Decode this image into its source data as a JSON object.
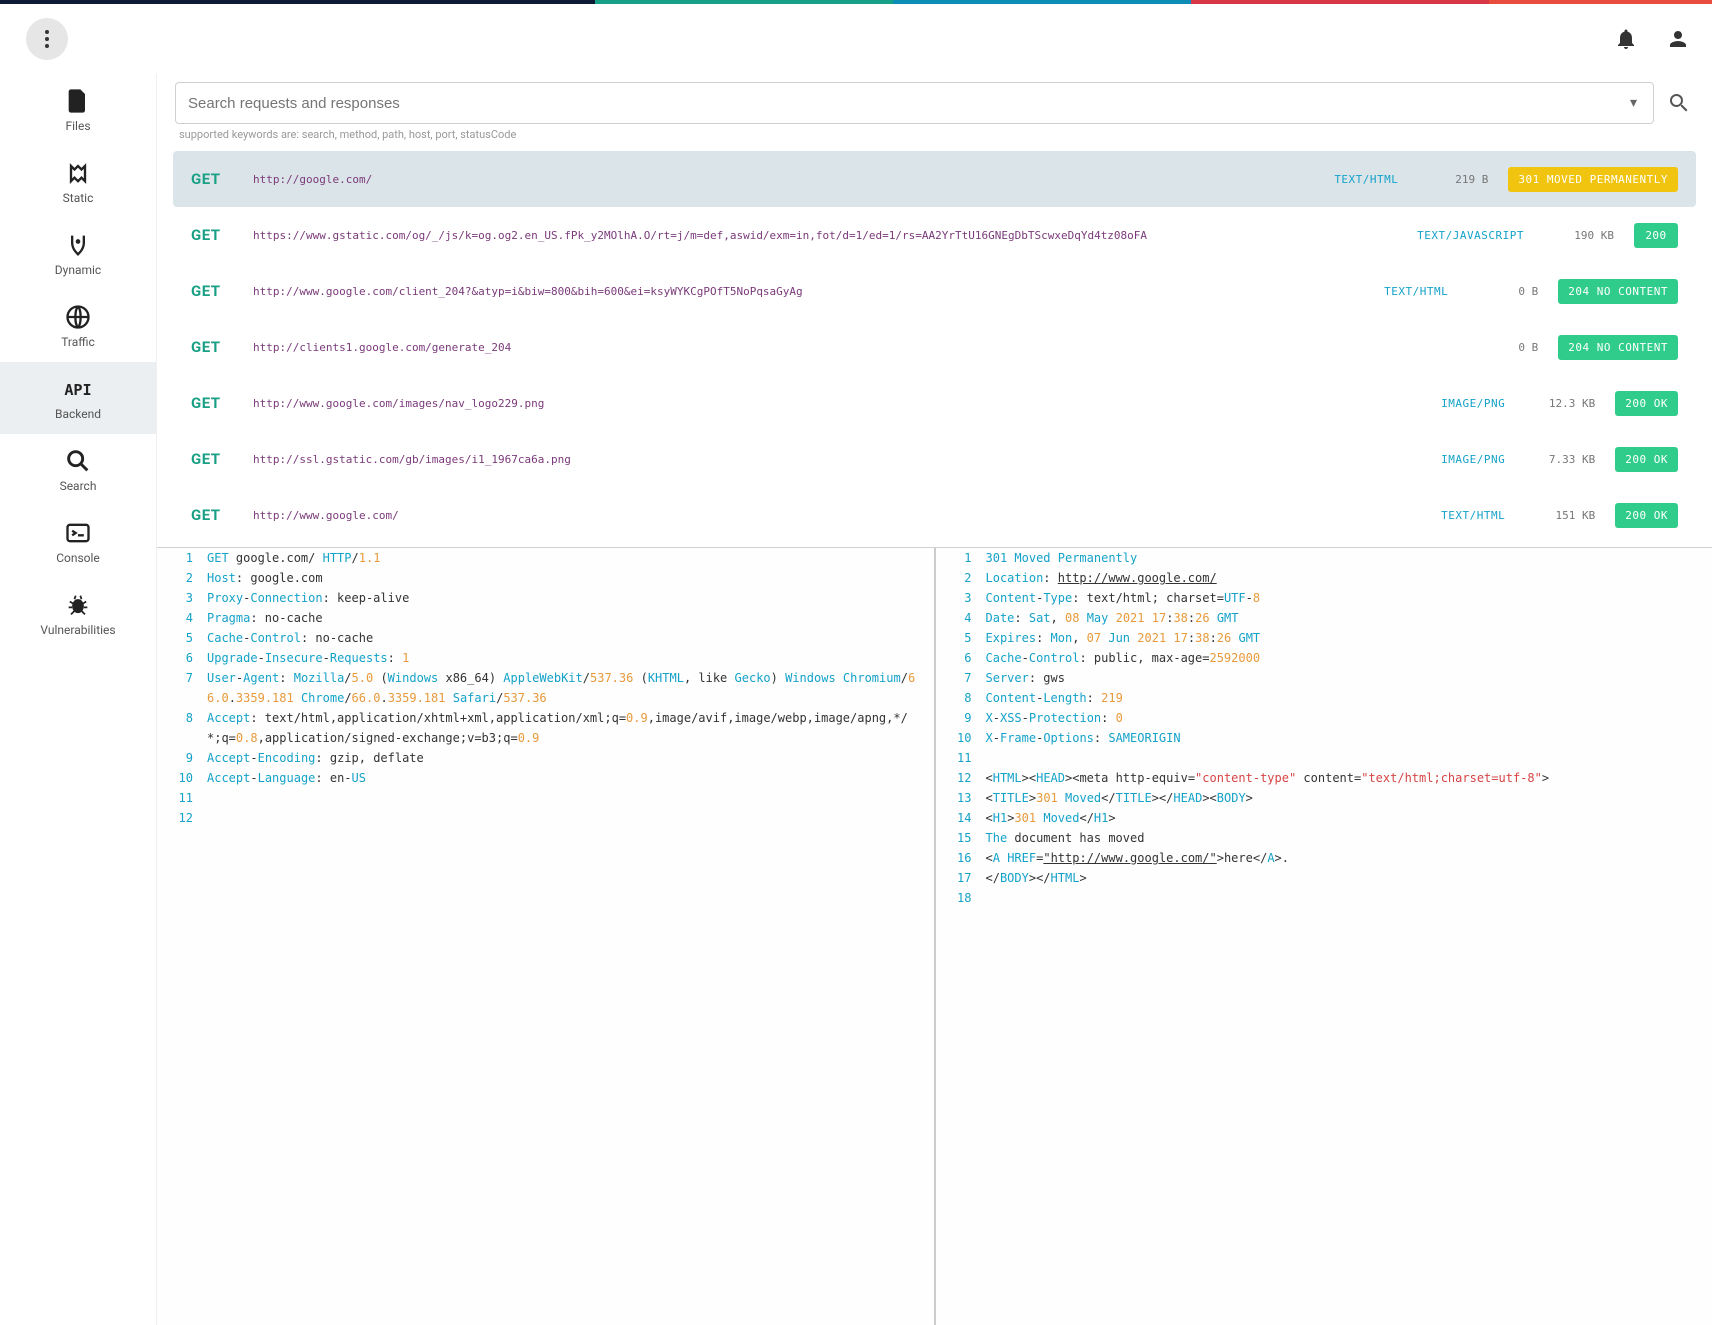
{
  "search": {
    "placeholder": "Search requests and responses",
    "hint": "supported keywords are: search, method, path, host, port, statusCode"
  },
  "sidebar": [
    {
      "id": "files",
      "label": "Files"
    },
    {
      "id": "static",
      "label": "Static"
    },
    {
      "id": "dynamic",
      "label": "Dynamic"
    },
    {
      "id": "traffic",
      "label": "Traffic"
    },
    {
      "id": "backend",
      "label": "Backend",
      "active": true
    },
    {
      "id": "search",
      "label": "Search"
    },
    {
      "id": "console",
      "label": "Console"
    },
    {
      "id": "vulnerabilities",
      "label": "Vulnerabilities"
    }
  ],
  "requests": [
    {
      "method": "GET",
      "url": "http://google.com/",
      "ct": "TEXT/HTML",
      "size": "219 B",
      "status": "301 MOVED PERMANENTLY",
      "style": "orange",
      "selected": true
    },
    {
      "method": "GET",
      "url": "https://www.gstatic.com/og/_/js/k=og.og2.en_US.fPk_y2MOlhA.O/rt=j/m=def,aswid/exm=in,fot/d=1/ed=1/rs=AA2YrTtU16GNEgDbTScwxeDqYd4tz08oFA",
      "ct": "TEXT/JAVASCRIPT",
      "size": "190 KB",
      "status": "200",
      "style": "green-sm"
    },
    {
      "method": "GET",
      "url": "http://www.google.com/client_204?&atyp=i&biw=800&bih=600&ei=ksyWYKCgPOfT5NoPqsaGyAg",
      "ct": "TEXT/HTML",
      "size": "0 B",
      "status": "204 NO CONTENT",
      "style": "green"
    },
    {
      "method": "GET",
      "url": "http://clients1.google.com/generate_204",
      "ct": "",
      "size": "0 B",
      "status": "204 NO CONTENT",
      "style": "green"
    },
    {
      "method": "GET",
      "url": "http://www.google.com/images/nav_logo229.png",
      "ct": "IMAGE/PNG",
      "size": "12.3 KB",
      "status": "200 OK",
      "style": "green"
    },
    {
      "method": "GET",
      "url": "http://ssl.gstatic.com/gb/images/i1_1967ca6a.png",
      "ct": "IMAGE/PNG",
      "size": "7.33 KB",
      "status": "200 OK",
      "style": "green"
    },
    {
      "method": "GET",
      "url": "http://www.google.com/",
      "ct": "TEXT/HTML",
      "size": "151 KB",
      "status": "200 OK",
      "style": "green"
    }
  ],
  "request_lines": [
    [
      {
        "t": "GET",
        "c": "kw"
      },
      {
        "t": " google.com/ "
      },
      {
        "t": "HTTP",
        "c": "kw"
      },
      {
        "t": "/"
      },
      {
        "t": "1.1",
        "c": "num"
      }
    ],
    [
      {
        "t": "Host",
        "c": "kw"
      },
      {
        "t": ": google.com"
      }
    ],
    [
      {
        "t": "Proxy",
        "c": "kw"
      },
      {
        "t": "-"
      },
      {
        "t": "Connection",
        "c": "kw"
      },
      {
        "t": ": keep-alive"
      }
    ],
    [
      {
        "t": "Pragma",
        "c": "kw"
      },
      {
        "t": ": no-cache"
      }
    ],
    [
      {
        "t": "Cache",
        "c": "kw"
      },
      {
        "t": "-"
      },
      {
        "t": "Control",
        "c": "kw"
      },
      {
        "t": ": no-cache"
      }
    ],
    [
      {
        "t": "Upgrade",
        "c": "kw"
      },
      {
        "t": "-"
      },
      {
        "t": "Insecure",
        "c": "kw"
      },
      {
        "t": "-"
      },
      {
        "t": "Requests",
        "c": "kw"
      },
      {
        "t": ": "
      },
      {
        "t": "1",
        "c": "num"
      }
    ],
    [
      {
        "t": "User",
        "c": "kw"
      },
      {
        "t": "-"
      },
      {
        "t": "Agent",
        "c": "kw"
      },
      {
        "t": ": "
      },
      {
        "t": "Mozilla",
        "c": "kw"
      },
      {
        "t": "/"
      },
      {
        "t": "5.0",
        "c": "num"
      },
      {
        "t": " ("
      },
      {
        "t": "Windows",
        "c": "kw"
      },
      {
        "t": " x86_64) "
      },
      {
        "t": "AppleWebKit",
        "c": "kw"
      },
      {
        "t": "/"
      },
      {
        "t": "537.36",
        "c": "num"
      },
      {
        "t": " ("
      },
      {
        "t": "KHTML",
        "c": "kw"
      },
      {
        "t": ", like "
      },
      {
        "t": "Gecko",
        "c": "kw"
      },
      {
        "t": ") "
      },
      {
        "t": "Windows",
        "c": "kw"
      },
      {
        "t": " "
      },
      {
        "t": "Chromium",
        "c": "kw"
      },
      {
        "t": "/"
      },
      {
        "t": "66.0",
        "c": "num"
      },
      {
        "t": "."
      },
      {
        "t": "3359.181",
        "c": "num"
      },
      {
        "t": " "
      },
      {
        "t": "Chrome",
        "c": "kw"
      },
      {
        "t": "/"
      },
      {
        "t": "66.0",
        "c": "num"
      },
      {
        "t": "."
      },
      {
        "t": "3359.181",
        "c": "num"
      },
      {
        "t": " "
      },
      {
        "t": "Safari",
        "c": "kw"
      },
      {
        "t": "/"
      },
      {
        "t": "537.36",
        "c": "num"
      }
    ],
    [
      {
        "t": "Accept",
        "c": "kw"
      },
      {
        "t": ": text/html,application/xhtml+xml,application/xml;q="
      },
      {
        "t": "0.9",
        "c": "num"
      },
      {
        "t": ",image/avif,image/webp,image/apng,*/*;q="
      },
      {
        "t": "0.8",
        "c": "num"
      },
      {
        "t": ",application/signed-exchange;v=b3;q="
      },
      {
        "t": "0.9",
        "c": "num"
      }
    ],
    [
      {
        "t": "Accept",
        "c": "kw"
      },
      {
        "t": "-"
      },
      {
        "t": "Encoding",
        "c": "kw"
      },
      {
        "t": ": gzip, deflate"
      }
    ],
    [
      {
        "t": "Accept",
        "c": "kw"
      },
      {
        "t": "-"
      },
      {
        "t": "Language",
        "c": "kw"
      },
      {
        "t": ": en-"
      },
      {
        "t": "US",
        "c": "kw"
      }
    ],
    [],
    []
  ],
  "response_lines": [
    [
      {
        "t": "301 Moved Permanently",
        "c": "kw"
      }
    ],
    [
      {
        "t": "Location",
        "c": "kw"
      },
      {
        "t": ": "
      },
      {
        "t": "http://www.google.com/",
        "c": "link"
      }
    ],
    [
      {
        "t": "Content",
        "c": "kw"
      },
      {
        "t": "-"
      },
      {
        "t": "Type",
        "c": "kw"
      },
      {
        "t": ": text/html; charset="
      },
      {
        "t": "UTF",
        "c": "kw"
      },
      {
        "t": "-"
      },
      {
        "t": "8",
        "c": "num"
      }
    ],
    [
      {
        "t": "Date",
        "c": "kw"
      },
      {
        "t": ": "
      },
      {
        "t": "Sat",
        "c": "kw"
      },
      {
        "t": ", "
      },
      {
        "t": "08",
        "c": "num"
      },
      {
        "t": " "
      },
      {
        "t": "May",
        "c": "kw"
      },
      {
        "t": " "
      },
      {
        "t": "2021",
        "c": "num"
      },
      {
        "t": " "
      },
      {
        "t": "17",
        "c": "num"
      },
      {
        "t": ":"
      },
      {
        "t": "38",
        "c": "num"
      },
      {
        "t": ":"
      },
      {
        "t": "26",
        "c": "num"
      },
      {
        "t": " "
      },
      {
        "t": "GMT",
        "c": "kw"
      }
    ],
    [
      {
        "t": "Expires",
        "c": "kw"
      },
      {
        "t": ": "
      },
      {
        "t": "Mon",
        "c": "kw"
      },
      {
        "t": ", "
      },
      {
        "t": "07",
        "c": "num"
      },
      {
        "t": " "
      },
      {
        "t": "Jun",
        "c": "kw"
      },
      {
        "t": " "
      },
      {
        "t": "2021",
        "c": "num"
      },
      {
        "t": " "
      },
      {
        "t": "17",
        "c": "num"
      },
      {
        "t": ":"
      },
      {
        "t": "38",
        "c": "num"
      },
      {
        "t": ":"
      },
      {
        "t": "26",
        "c": "num"
      },
      {
        "t": " "
      },
      {
        "t": "GMT",
        "c": "kw"
      }
    ],
    [
      {
        "t": "Cache",
        "c": "kw"
      },
      {
        "t": "-"
      },
      {
        "t": "Control",
        "c": "kw"
      },
      {
        "t": ": public, max-age="
      },
      {
        "t": "2592000",
        "c": "num"
      }
    ],
    [
      {
        "t": "Server",
        "c": "kw"
      },
      {
        "t": ": gws"
      }
    ],
    [
      {
        "t": "Content",
        "c": "kw"
      },
      {
        "t": "-"
      },
      {
        "t": "Length",
        "c": "kw"
      },
      {
        "t": ": "
      },
      {
        "t": "219",
        "c": "num"
      }
    ],
    [
      {
        "t": "X",
        "c": "kw"
      },
      {
        "t": "-"
      },
      {
        "t": "XSS",
        "c": "kw"
      },
      {
        "t": "-"
      },
      {
        "t": "Protection",
        "c": "kw"
      },
      {
        "t": ": "
      },
      {
        "t": "0",
        "c": "num"
      }
    ],
    [
      {
        "t": "X",
        "c": "kw"
      },
      {
        "t": "-"
      },
      {
        "t": "Frame",
        "c": "kw"
      },
      {
        "t": "-"
      },
      {
        "t": "Options",
        "c": "kw"
      },
      {
        "t": ": "
      },
      {
        "t": "SAMEORIGIN",
        "c": "kw"
      }
    ],
    [],
    [
      {
        "t": "<"
      },
      {
        "t": "HTML",
        "c": "kw"
      },
      {
        "t": "><"
      },
      {
        "t": "HEAD",
        "c": "kw"
      },
      {
        "t": "><meta http-equiv="
      },
      {
        "t": "\"content-type\"",
        "c": "str"
      },
      {
        "t": " content="
      },
      {
        "t": "\"text/html;charset=utf-8\"",
        "c": "str"
      },
      {
        "t": ">"
      }
    ],
    [
      {
        "t": "<"
      },
      {
        "t": "TITLE",
        "c": "kw"
      },
      {
        "t": ">"
      },
      {
        "t": "301",
        "c": "num"
      },
      {
        "t": " "
      },
      {
        "t": "Moved",
        "c": "kw"
      },
      {
        "t": "</"
      },
      {
        "t": "TITLE",
        "c": "kw"
      },
      {
        "t": "></"
      },
      {
        "t": "HEAD",
        "c": "kw"
      },
      {
        "t": "><"
      },
      {
        "t": "BODY",
        "c": "kw"
      },
      {
        "t": ">"
      }
    ],
    [
      {
        "t": "<"
      },
      {
        "t": "H1",
        "c": "kw"
      },
      {
        "t": ">"
      },
      {
        "t": "301",
        "c": "num"
      },
      {
        "t": " "
      },
      {
        "t": "Moved",
        "c": "kw"
      },
      {
        "t": "</"
      },
      {
        "t": "H1",
        "c": "kw"
      },
      {
        "t": ">"
      }
    ],
    [
      {
        "t": "The",
        "c": "kw"
      },
      {
        "t": " document has moved"
      }
    ],
    [
      {
        "t": "<"
      },
      {
        "t": "A",
        "c": "kw"
      },
      {
        "t": " "
      },
      {
        "t": "HREF",
        "c": "kw"
      },
      {
        "t": "="
      },
      {
        "t": "\"http://www.google.com/\"",
        "c": "str link"
      },
      {
        "t": ">here</"
      },
      {
        "t": "A",
        "c": "kw"
      },
      {
        "t": ">."
      }
    ],
    [
      {
        "t": "</"
      },
      {
        "t": "BODY",
        "c": "kw"
      },
      {
        "t": "></"
      },
      {
        "t": "HTML",
        "c": "kw"
      },
      {
        "t": ">"
      }
    ],
    []
  ]
}
